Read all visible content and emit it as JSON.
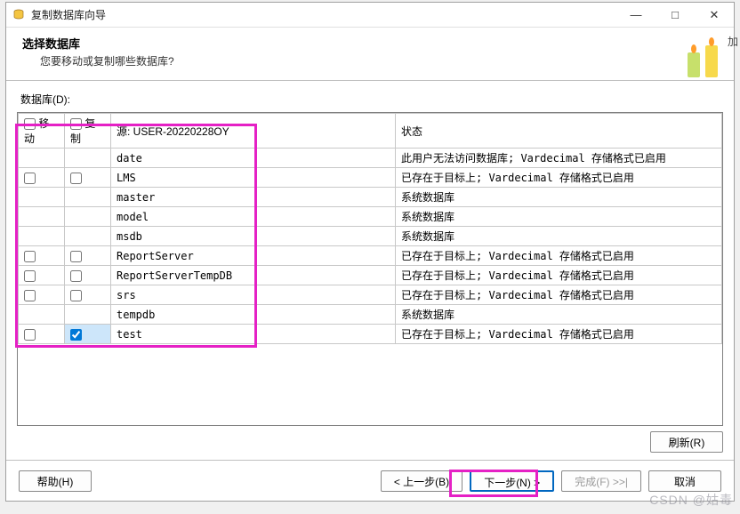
{
  "window": {
    "title": "复制数据库向导",
    "minimize": "—",
    "maximize": "□",
    "close": "✕"
  },
  "header": {
    "heading": "选择数据库",
    "subtext": "您要移动或复制哪些数据库?"
  },
  "extra_label": "加",
  "db_label": "数据库(D):",
  "columns": {
    "move": "移动",
    "copy": "复制",
    "source": "源: USER-20220228OY",
    "status": "状态"
  },
  "rows": [
    {
      "move": null,
      "copy": null,
      "source": "date",
      "status": "此用户无法访问数据库; Vardecimal 存储格式已启用"
    },
    {
      "move": false,
      "copy": false,
      "source": "LMS",
      "status": "已存在于目标上; Vardecimal 存储格式已启用"
    },
    {
      "move": null,
      "copy": null,
      "source": "master",
      "status": "系统数据库"
    },
    {
      "move": null,
      "copy": null,
      "source": "model",
      "status": "系统数据库"
    },
    {
      "move": null,
      "copy": null,
      "source": "msdb",
      "status": "系统数据库"
    },
    {
      "move": false,
      "copy": false,
      "source": "ReportServer",
      "status": "已存在于目标上; Vardecimal 存储格式已启用"
    },
    {
      "move": false,
      "copy": false,
      "source": "ReportServerTempDB",
      "status": "已存在于目标上; Vardecimal 存储格式已启用"
    },
    {
      "move": false,
      "copy": false,
      "source": "srs",
      "status": "已存在于目标上; Vardecimal 存储格式已启用"
    },
    {
      "move": null,
      "copy": null,
      "source": "tempdb",
      "status": "系统数据库"
    },
    {
      "move": false,
      "copy": true,
      "source": "test",
      "status": "已存在于目标上; Vardecimal 存储格式已启用"
    }
  ],
  "buttons": {
    "refresh": "刷新(R)",
    "help": "帮助(H)",
    "back": "< 上一步(B)",
    "next": "下一步(N) >",
    "finish": "完成(F) >>|",
    "cancel": "取消"
  },
  "watermark": "CSDN @姑毒"
}
